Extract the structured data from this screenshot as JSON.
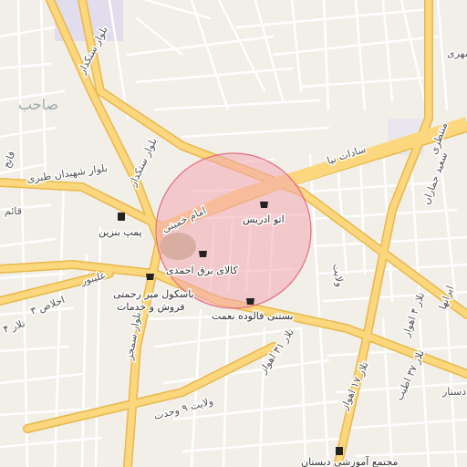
{
  "map": {
    "colors": {
      "background": "#f2efe9",
      "minor_road": "#ffffff",
      "major_road": "#fcd77d",
      "major_road_casing": "#e8b84a",
      "circle_fill": "#f3a7b3",
      "circle_stroke": "#e46d82",
      "park": "#b9b48e",
      "landuse": "#dcd8ec"
    },
    "streets": [
      {
        "id": "s1",
        "name": "بلوار ستکدار"
      },
      {
        "id": "s2",
        "name": "بلوار ستکدار"
      },
      {
        "id": "s3",
        "name": "بلوار شهیدان طبری"
      },
      {
        "id": "s4",
        "name": "سادات نیا"
      },
      {
        "id": "s5",
        "name": "صاحب"
      },
      {
        "id": "s6",
        "name": "منتظری"
      },
      {
        "id": "s7",
        "name": "سعید جماران"
      },
      {
        "id": "s8",
        "name": "علیبور"
      },
      {
        "id": "s9",
        "name": "اخلاص ۳"
      },
      {
        "id": "s10",
        "name": "بلوار سمجز"
      },
      {
        "id": "s11",
        "name": "ولایت ۹ وحدت"
      },
      {
        "id": "s12",
        "name": "تلار ۳۱ اهواز"
      },
      {
        "id": "s13",
        "name": "تلار ۱۷ اهواز"
      },
      {
        "id": "s14",
        "name": "تلار ۳۷ اطیب"
      },
      {
        "id": "s15",
        "name": "امام خمینی"
      },
      {
        "id": "s16",
        "name": "تلار ۴"
      },
      {
        "id": "s17",
        "name": "تلار ۴ اهواز"
      },
      {
        "id": "s18",
        "name": "ایرانها"
      },
      {
        "id": "s19",
        "name": "فاتح"
      },
      {
        "id": "s20",
        "name": "قائم"
      },
      {
        "id": "s21",
        "name": "ولایت"
      },
      {
        "id": "s22",
        "name": "مهری"
      },
      {
        "id": "s23",
        "name": "دستار"
      }
    ],
    "pois": [
      {
        "name": "پمپ بنزین",
        "icon": "fuel-icon"
      },
      {
        "name": "اتو ادریس",
        "icon": "shop-icon"
      },
      {
        "name": "کالای برق احمدی",
        "icon": "shop-icon"
      },
      {
        "name": "باسکول میر رحمتی",
        "icon": "shop-icon"
      },
      {
        "name": "فروش و خدمات",
        "icon": "shop-icon"
      },
      {
        "name": "بستنی فالوده نعمت",
        "icon": "shop-icon"
      },
      {
        "name": "مجتمع آموزشی دبستان",
        "icon": "school-icon"
      }
    ]
  }
}
